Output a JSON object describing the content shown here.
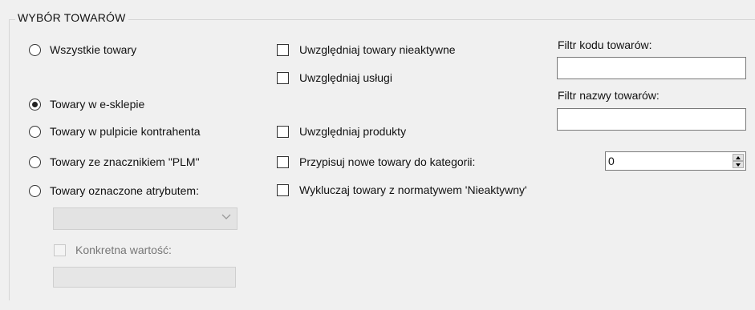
{
  "group": {
    "title": "WYBÓR TOWARÓW"
  },
  "radios": [
    {
      "label": "Wszystkie towary",
      "checked": false
    },
    {
      "label": "Towary w e-sklepie",
      "checked": true
    },
    {
      "label": "Towary w pulpicie kontrahenta",
      "checked": false
    },
    {
      "label": "Towary ze znacznikiem \"PLM\"",
      "checked": false
    },
    {
      "label": "Towary oznaczone atrybutem:",
      "checked": false
    }
  ],
  "attribute": {
    "select_value": "",
    "specific_value_label": "Konkretna wartość:",
    "specific_value_checked": false,
    "specific_value": ""
  },
  "checks": [
    {
      "label": "Uwzględniaj towary nieaktywne",
      "checked": false
    },
    {
      "label": "Uwzględniaj usługi",
      "checked": false
    },
    {
      "label": "Uwzględniaj produkty",
      "checked": false
    },
    {
      "label": "Przypisuj nowe towary do kategorii:",
      "checked": false
    },
    {
      "label": "Wykluczaj towary z normatywem 'Nieaktywny'",
      "checked": false
    }
  ],
  "filters": {
    "code_label": "Filtr kodu towarów:",
    "code_value": "",
    "name_label": "Filtr nazwy towarów:",
    "name_value": ""
  },
  "category": {
    "value": "0"
  }
}
